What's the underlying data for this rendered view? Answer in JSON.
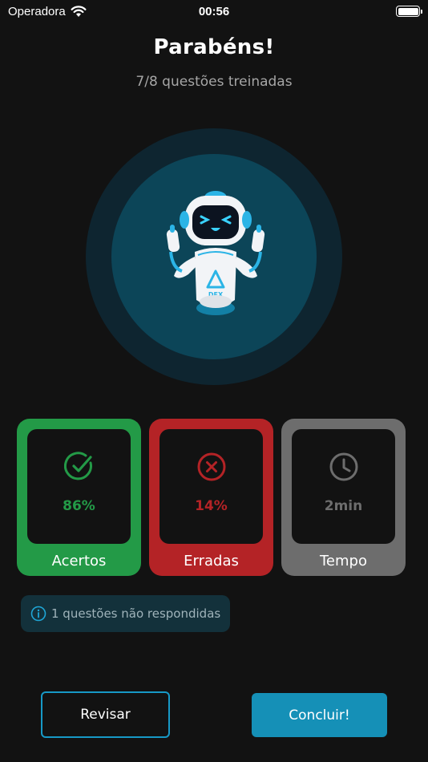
{
  "status_bar": {
    "carrier": "Operadora",
    "time": "00:56"
  },
  "header": {
    "title": "Parabéns!",
    "subtitle": "7/8 questões treinadas"
  },
  "mascot": {
    "badge_text": "DEX"
  },
  "stats": {
    "correct": {
      "value": "86%",
      "label": "Acertos",
      "color": "#239a47",
      "icon": "check-circle-icon"
    },
    "wrong": {
      "value": "14%",
      "label": "Erradas",
      "color": "#b42326",
      "icon": "x-circle-icon"
    },
    "time": {
      "value": "2min",
      "label": "Tempo",
      "color": "#6d6d6d",
      "icon": "clock-icon"
    }
  },
  "info": {
    "text": "1 questões não respondidas",
    "icon": "info-icon"
  },
  "actions": {
    "review_label": "Revisar",
    "finish_label": "Concluir!"
  },
  "colors": {
    "background": "#121212",
    "accent": "#1590b7"
  }
}
